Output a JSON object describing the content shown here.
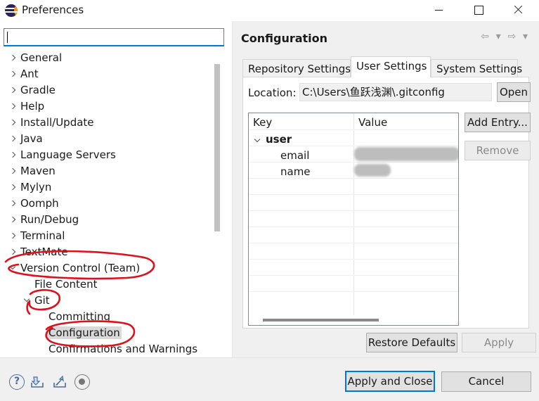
{
  "window": {
    "title": "Preferences"
  },
  "filter": {
    "value": ""
  },
  "tree": {
    "items": [
      {
        "label": "General",
        "expander": "collapsed"
      },
      {
        "label": "Ant",
        "expander": "collapsed"
      },
      {
        "label": "Gradle",
        "expander": "collapsed"
      },
      {
        "label": "Help",
        "expander": "collapsed"
      },
      {
        "label": "Install/Update",
        "expander": "collapsed"
      },
      {
        "label": "Java",
        "expander": "collapsed"
      },
      {
        "label": "Language Servers",
        "expander": "collapsed"
      },
      {
        "label": "Maven",
        "expander": "collapsed"
      },
      {
        "label": "Mylyn",
        "expander": "collapsed"
      },
      {
        "label": "Oomph",
        "expander": "collapsed"
      },
      {
        "label": "Run/Debug",
        "expander": "collapsed"
      },
      {
        "label": "Terminal",
        "expander": "collapsed"
      },
      {
        "label": "TextMate",
        "expander": "collapsed"
      },
      {
        "label": "Version Control (Team)",
        "expander": "expanded"
      },
      {
        "label": "File Content",
        "expander": "none"
      },
      {
        "label": "Git",
        "expander": "expanded"
      },
      {
        "label": "Committing",
        "expander": "none"
      },
      {
        "label": "Configuration",
        "expander": "none",
        "selected": true
      },
      {
        "label": "Confirmations and Warnings",
        "expander": "none"
      }
    ]
  },
  "page": {
    "title": "Configuration",
    "nav": {
      "back": "⇦",
      "forward": "⇨",
      "menu": "▾"
    }
  },
  "tabs": [
    {
      "label": "Repository Settings",
      "active": false
    },
    {
      "label": "User Settings",
      "active": true
    },
    {
      "label": "System Settings",
      "active": false
    }
  ],
  "location": {
    "label": "Location:",
    "value": "C:\\Users\\鱼跃浅渊\\.gitconfig",
    "open_label": "Open"
  },
  "table": {
    "headers": {
      "key": "Key",
      "value": "Value"
    },
    "section": "user",
    "rows": [
      {
        "key": "email",
        "value": ""
      },
      {
        "key": "name",
        "value": ""
      }
    ]
  },
  "buttons": {
    "add_entry": "Add Entry...",
    "remove": "Remove",
    "restore_defaults": "Restore Defaults",
    "apply": "Apply",
    "apply_and_close": "Apply and Close",
    "cancel": "Cancel"
  },
  "footer_icons": [
    "help-icon",
    "import-icon",
    "export-icon",
    "record-icon"
  ],
  "colors": {
    "accent": "#0078d7",
    "annotation": "#e0101a",
    "selection": "#d9d9d9",
    "panel_bg": "#f0f0f0"
  }
}
